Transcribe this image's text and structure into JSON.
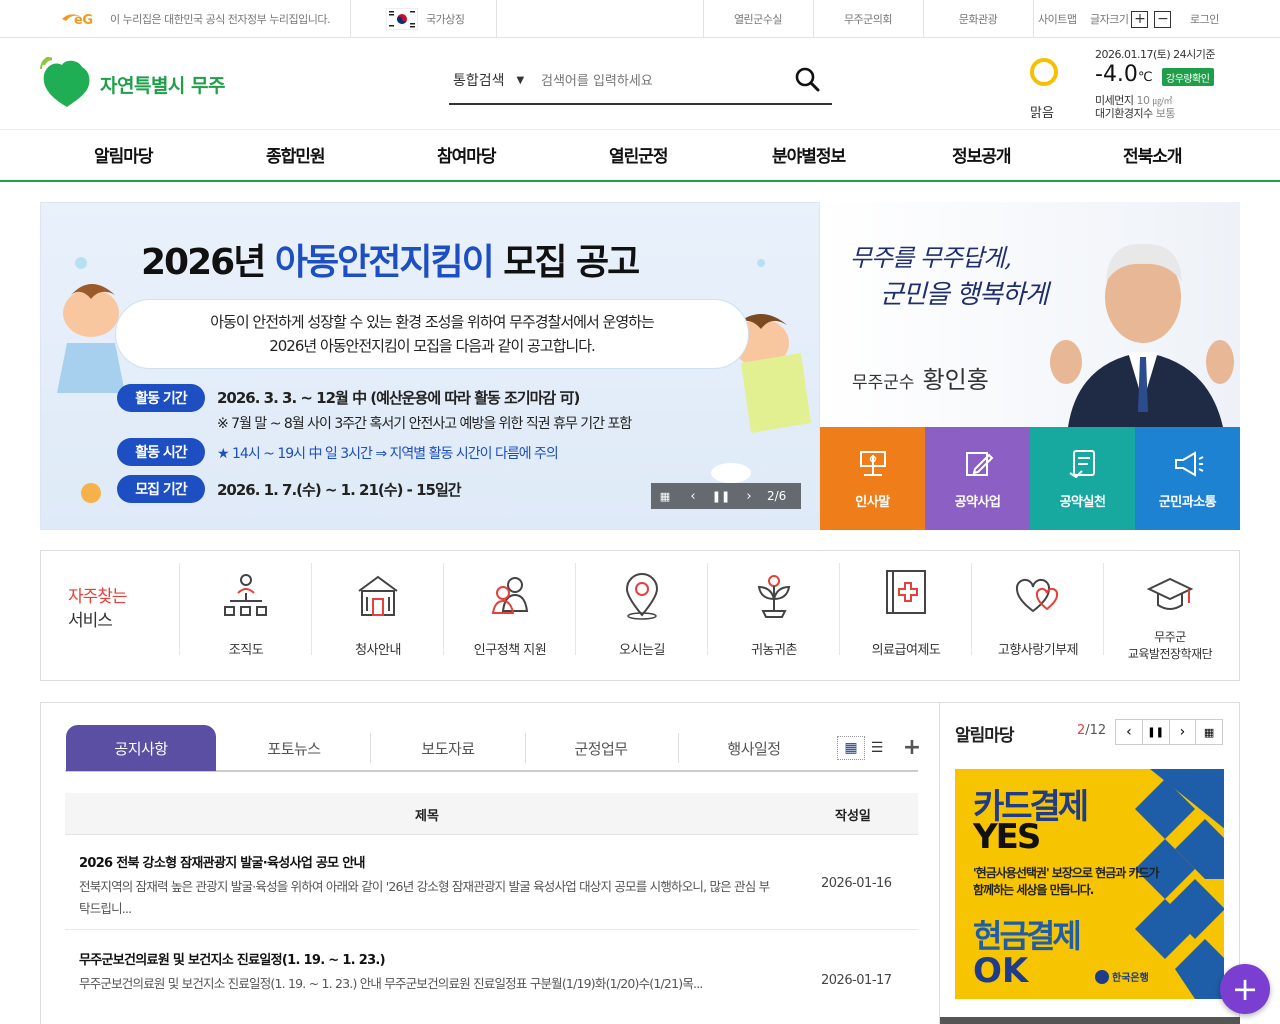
{
  "utility": {
    "gov_notice": "이 누리집은 대한민국 공식 전자정부 누리집입니다.",
    "national_symbol": "국가상징",
    "links": [
      "열린군수실",
      "무주군의회",
      "문화관광"
    ],
    "sitemap": "사이트맵",
    "font_size": "글자크기",
    "login": "로그인"
  },
  "header": {
    "logo_text": "자연특별시 무주",
    "search_category": "통합검색",
    "search_placeholder": "검색어를 입력하세요"
  },
  "weather": {
    "date": "2026.01.17(토) 24시기준",
    "temp": "-4.0",
    "unit": "℃",
    "rain_btn": "강우량확인",
    "condition": "맑음",
    "dust_label": "미세먼지",
    "dust_value": "10",
    "dust_unit": "㎍/㎥",
    "air_label": "대기환경지수",
    "air_value": "보통"
  },
  "gnb": [
    "알림마당",
    "종합민원",
    "참여마당",
    "열린군정",
    "분야별정보",
    "정보공개",
    "전북소개"
  ],
  "banner": {
    "title_year": "2026년 ",
    "title_main": "아동안전지킴이",
    "title_tail": " 모집 공고",
    "desc1": "아동이 안전하게 성장할 수 있는 환경 조성을 위하여 무주경찰서에서 운영하는",
    "desc2": "2026년 아동안전지킴이 모집을 다음과 같이 공고합니다.",
    "rows": [
      {
        "label": "활동 기간",
        "text": "2026. 3. 3. ~ 12월 中 (예산운용에 따라 활동 조기마감 可)"
      },
      {
        "label": "",
        "text": "※ 7월 말 ~ 8월 사이 3주간 혹서기 안전사고 예방을 위한 직권 휴무 기간 포함"
      },
      {
        "label": "활동 시간",
        "text": "★ 14시 ~ 19시 中 일 3시간 ⇒ 지역별 활동 시간이 다름에 주의"
      },
      {
        "label": "모집 기간",
        "text": "2026. 1. 7.(수) ~ 1. 21(수) - 15일간"
      }
    ],
    "counter": "2/6"
  },
  "mayor": {
    "slogan1": "무주를 무주답게,",
    "slogan2": "군민을 행복하게",
    "title": "무주군수",
    "name": "황인홍"
  },
  "quick_buttons": [
    {
      "label": "인사말",
      "color": "#ef7d1a",
      "icon": "podium-icon"
    },
    {
      "label": "공약사업",
      "color": "#8b5fc4",
      "icon": "edit-icon"
    },
    {
      "label": "공약실천",
      "color": "#17a8a0",
      "icon": "checklist-icon"
    },
    {
      "label": "군민과소통",
      "color": "#1e82d2",
      "icon": "megaphone-icon"
    }
  ],
  "services": {
    "title1": "자주찾는",
    "title2": "서비스",
    "items": [
      {
        "label": "조직도",
        "icon": "org-chart-icon"
      },
      {
        "label": "청사안내",
        "icon": "building-icon"
      },
      {
        "label": "인구정책 지원",
        "icon": "people-icon"
      },
      {
        "label": "오시는길",
        "icon": "location-pin-icon"
      },
      {
        "label": "귀농귀촌",
        "icon": "sprout-icon"
      },
      {
        "label": "의료급여제도",
        "icon": "medical-icon"
      },
      {
        "label": "고향사랑기부제",
        "icon": "hearts-icon"
      },
      {
        "label": "무주군\n교육발전장학재단",
        "icon": "graduation-cap-icon"
      }
    ]
  },
  "board": {
    "tabs": [
      "공지사항",
      "포토뉴스",
      "보도자료",
      "군정업무",
      "행사일정"
    ],
    "col_title": "제목",
    "col_date": "작성일",
    "rows": [
      {
        "title": "2026 전북 강소형 잠재관광지 발굴·육성사업 공모 안내",
        "summary": "전북지역의 잠재력 높은 관광지 발굴·육성을 위하여 아래와 같이 '26년 강소형 잠재관광지 발굴 육성사업 대상지 공모를 시행하오니, 많은 관심 부탁드립니...",
        "date": "2026-01-16"
      },
      {
        "title": "무주군보건의료원 및 보건지소 진료일정(1. 19. ~ 1. 23.)",
        "summary": "무주군보건의료원 및 보건지소 진료일정(1. 19. ~ 1. 23.) 안내 무주군보건의료원 진료일정표 구분월(1/19)화(1/20)수(1/21)목...",
        "date": "2026-01-17"
      }
    ]
  },
  "notice_side": {
    "title": "알림마당",
    "current": "2",
    "total": "/12",
    "ad_line1": "카드결제",
    "ad_line2": "YES",
    "ad_desc1": "'현금사용선택권' 보장으로 현금과 카드가",
    "ad_desc2": "함께하는 세상을 만듭니다.",
    "ad_line3": "현금결제",
    "ad_line4": "OK",
    "bank": "한국은행"
  }
}
